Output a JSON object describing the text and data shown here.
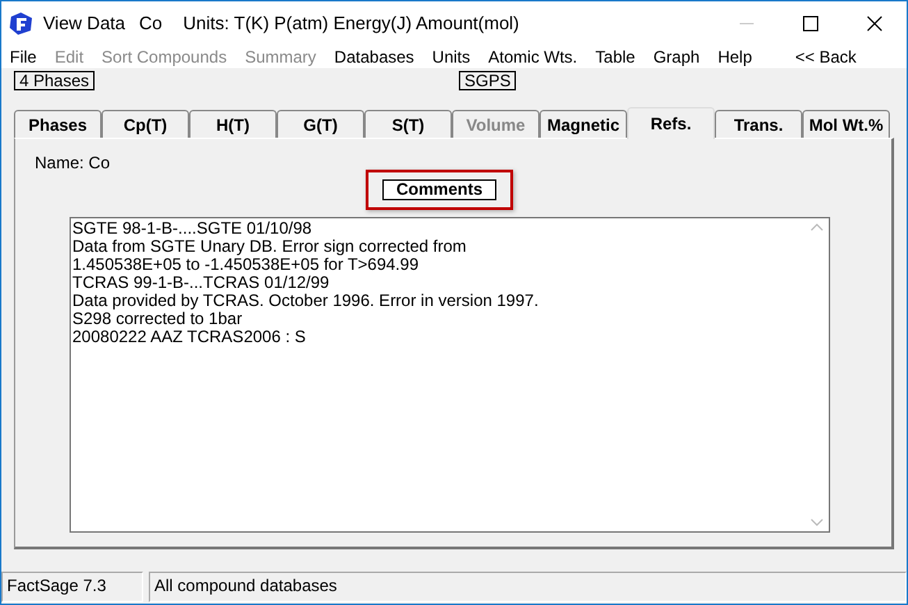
{
  "window": {
    "title": "View Data",
    "compound": "Co",
    "units": "Units:  T(K) P(atm) Energy(J) Amount(mol)"
  },
  "menu": [
    {
      "label": "File",
      "disabled": false
    },
    {
      "label": "Edit",
      "disabled": true
    },
    {
      "label": "Sort Compounds",
      "disabled": true
    },
    {
      "label": "Summary",
      "disabled": true
    },
    {
      "label": "Databases",
      "disabled": false
    },
    {
      "label": "Units",
      "disabled": false
    },
    {
      "label": "Atomic Wts.",
      "disabled": false
    },
    {
      "label": "Table",
      "disabled": false
    },
    {
      "label": "Graph",
      "disabled": false
    },
    {
      "label": "Help",
      "disabled": false
    }
  ],
  "back": "<<  Back",
  "phases_badge": "4 Phases",
  "database_badge": "SGPS",
  "tabs": [
    {
      "label": "Phases",
      "selected": false,
      "disabled": false
    },
    {
      "label": "Cp(T)",
      "selected": false,
      "disabled": false
    },
    {
      "label": "H(T)",
      "selected": false,
      "disabled": false
    },
    {
      "label": "G(T)",
      "selected": false,
      "disabled": false
    },
    {
      "label": "S(T)",
      "selected": false,
      "disabled": false
    },
    {
      "label": "Volume",
      "selected": false,
      "disabled": true
    },
    {
      "label": "Magnetic",
      "selected": false,
      "disabled": false
    },
    {
      "label": "Refs.",
      "selected": true,
      "disabled": false
    },
    {
      "label": "Trans.",
      "selected": false,
      "disabled": false
    },
    {
      "label": "Mol Wt.%",
      "selected": false,
      "disabled": false
    }
  ],
  "name_label": "Name: Co",
  "comments_button": {
    "label": "Comments",
    "highlighted": true
  },
  "comments": [
    "SGTE 98-1-B-....SGTE 01/10/98",
    "Data from SGTE Unary DB. Error sign corrected from",
    "1.450538E+05 to -1.450538E+05 for T>694.99",
    "TCRAS 99-1-B-...TCRAS 01/12/99",
    "Data provided by TCRAS. October 1996. Error in version 1997.",
    "S298 corrected to 1bar",
    "20080222 AAZ TCRAS2006 : S"
  ],
  "status_bar": [
    "FactSage 7.3",
    "All compound databases"
  ]
}
